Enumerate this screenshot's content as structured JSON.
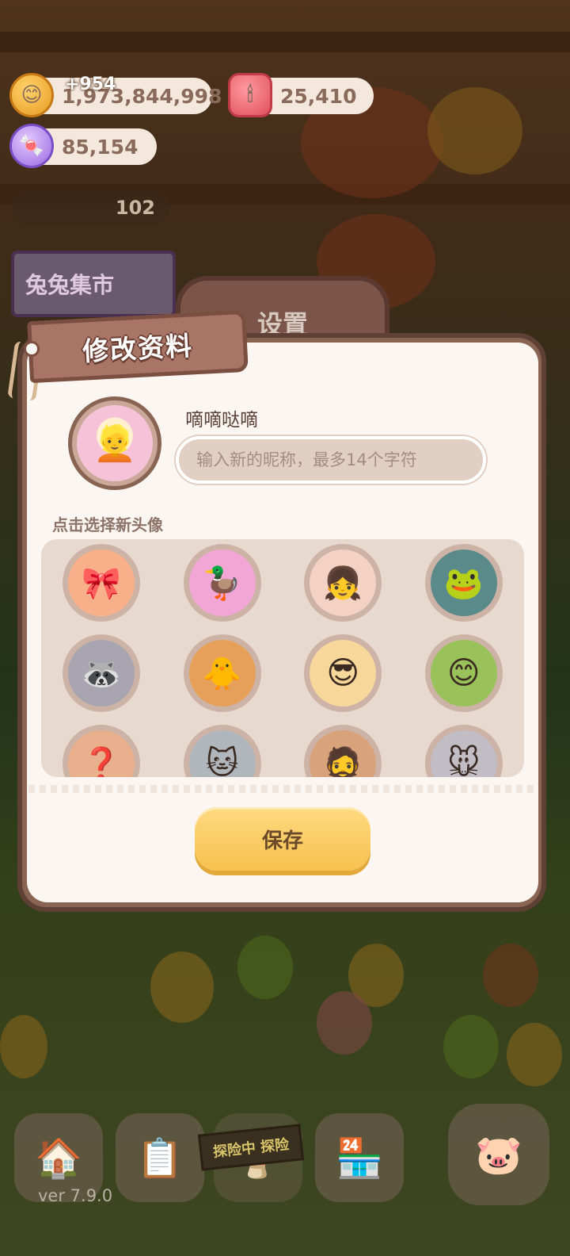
{
  "resources": {
    "coins": "1,973,844,998",
    "coins_delta": "+954",
    "candles": "25,410",
    "candy": "85,154",
    "dim_counter": "102"
  },
  "market_sign": "兔兔集市",
  "settings_title": "设置",
  "modal": {
    "title": "修改资料",
    "nickname": "嘀嘀哒嘀",
    "nickname_placeholder": "输入新的昵称，最多14个字符",
    "section_label": "点击选择新头像",
    "save_label": "保存"
  },
  "avatars": [
    {
      "icon": "🎀",
      "color": "#f7b08a"
    },
    {
      "icon": "🦆",
      "color": "#f2a6d6"
    },
    {
      "icon": "👧",
      "color": "#f3d2c4"
    },
    {
      "icon": "🐸",
      "color": "#5a8a8a"
    },
    {
      "icon": "🦝",
      "color": "#a8a4b0"
    },
    {
      "icon": "🐥",
      "color": "#e7a05a"
    },
    {
      "icon": "😎",
      "color": "#f7d79a"
    },
    {
      "icon": "😊",
      "color": "#9ac25a"
    },
    {
      "icon": "❓",
      "color": "#e8b08c"
    },
    {
      "icon": "🐱",
      "color": "#b0b6bc"
    },
    {
      "icon": "🧔",
      "color": "#d8a27a"
    },
    {
      "icon": "🐭",
      "color": "#c2bcc4"
    }
  ],
  "explore_label": "探险中 探险",
  "version": "ver 7.9.0"
}
